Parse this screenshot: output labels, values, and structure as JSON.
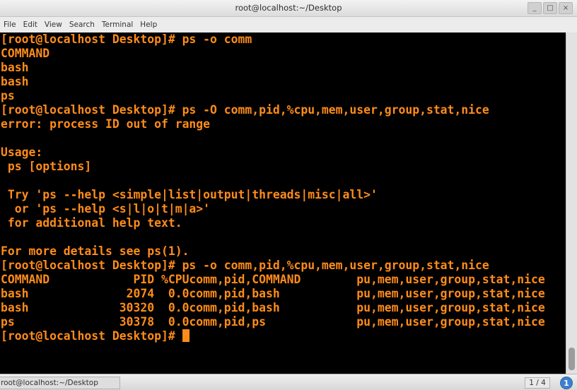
{
  "window": {
    "title": "root@localhost:~/Desktop",
    "buttons": {
      "minimize": "_",
      "maximize": "□",
      "close": "×"
    }
  },
  "menubar": {
    "items": [
      "File",
      "Edit",
      "View",
      "Search",
      "Terminal",
      "Help"
    ]
  },
  "terminal": {
    "lines": [
      "[root@localhost Desktop]# ps -o comm",
      "COMMAND",
      "bash",
      "bash",
      "ps",
      "[root@localhost Desktop]# ps -O comm,pid,%cpu,mem,user,group,stat,nice",
      "error: process ID out of range",
      "",
      "Usage:",
      " ps [options]",
      "",
      " Try 'ps --help <simple|list|output|threads|misc|all>'",
      "  or 'ps --help <s|l|o|t|m|a>'",
      " for additional help text.",
      "",
      "For more details see ps(1).",
      "[root@localhost Desktop]# ps -o comm,pid,%cpu,mem,user,group,stat,nice",
      "COMMAND            PID %CPUcomm,pid,COMMAND        pu,mem,user,group,stat,nice",
      "bash              2074  0.0comm,pid,bash           pu,mem,user,group,stat,nice",
      "bash             30320  0.0comm,pid,bash           pu,mem,user,group,stat,nice",
      "ps               30378  0.0comm,pid,ps             pu,mem,user,group,stat,nice"
    ],
    "prompt": "[root@localhost Desktop]# ",
    "text_color": "#ff8c1a",
    "background_color": "#000000"
  },
  "taskbar": {
    "window_entry": "root@localhost:~/Desktop",
    "pager": "1 / 4",
    "notification_badge": "1"
  }
}
